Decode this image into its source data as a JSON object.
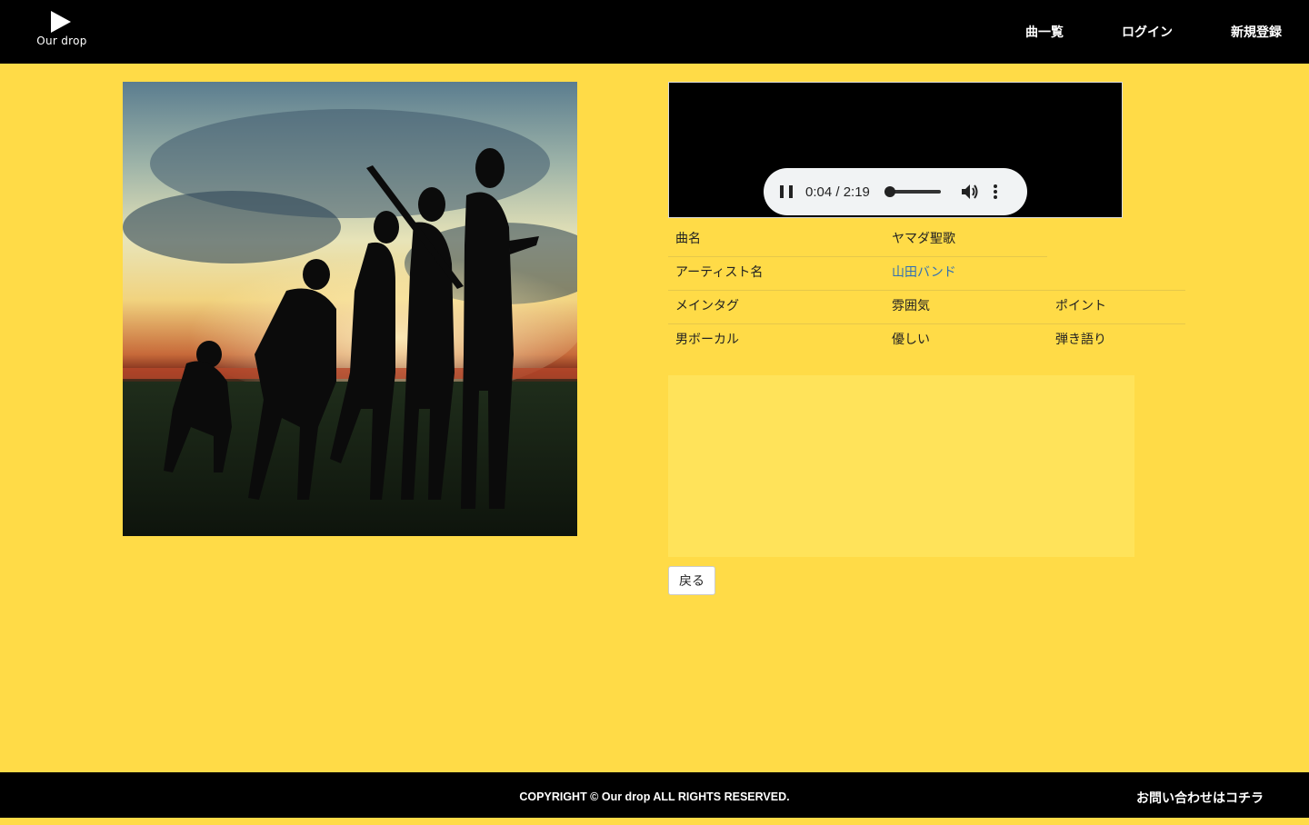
{
  "header": {
    "logo_text": "Our drop",
    "nav": [
      "曲一覧",
      "ログイン",
      "新規登録"
    ]
  },
  "player": {
    "time": "0:04 / 2:19",
    "progress_fraction": 0.03
  },
  "song": {
    "title_label": "曲名",
    "title": "ヤマダ聖歌",
    "artist_label": "アーティスト名",
    "artist": "山田バンド",
    "tag_headers": [
      "メインタグ",
      "雰囲気",
      "ポイント"
    ],
    "tags": [
      "男ボーカル",
      "優しい",
      "弾き語り"
    ]
  },
  "back_label": "戻る",
  "footer": {
    "copyright": "COPYRIGHT © Our drop ALL RIGHTS RESERVED.",
    "contact": "お問い合わせはコチラ"
  },
  "colors": {
    "background": "#FFDB47",
    "header": "#000000",
    "link": "#2F6FB5"
  }
}
